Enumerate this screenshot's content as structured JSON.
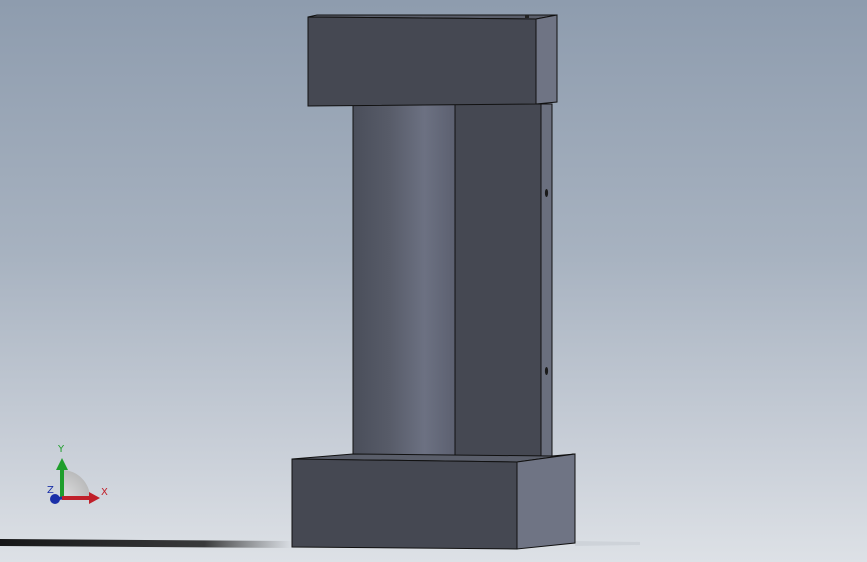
{
  "triad": {
    "x_label": "X",
    "y_label": "Y",
    "z_label": "Z",
    "x_color": "#c0202a",
    "y_color": "#1f9e2c",
    "z_color": "#1a2fa8"
  },
  "model": {
    "face_dark": "#454852",
    "face_side": "#6f7484",
    "face_top": "#5a5e6a",
    "edge": "#111111"
  },
  "background": {
    "top": "#8e9cae",
    "bottom": "#dde1e6"
  }
}
